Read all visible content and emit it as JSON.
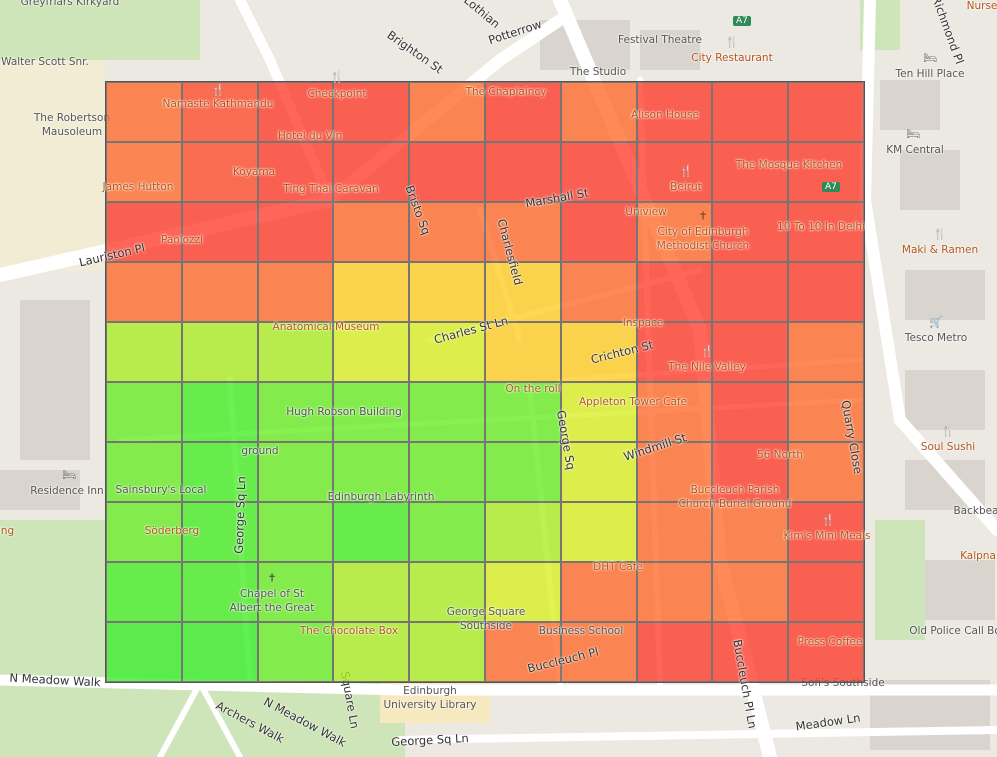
{
  "map": {
    "labels": {
      "greyfriars_kirkyard": "Greyfriars Kirkyard",
      "walter_scott": "Walter Scott Snr.",
      "robertson_mausoleum_1": "The Robertson",
      "robertson_mausoleum_2": "Mausoleum",
      "lothian": "Lothian",
      "brighton_st": "Brighton St",
      "potterrow": "Potterrow",
      "festival_theatre": "Festival Theatre",
      "the_studio": "The Studio",
      "city_restaurant": "City Restaurant",
      "nursery": "Nurse",
      "richmond_pl": "Richmond Pl",
      "ten_hill_place": "Ten Hill Place",
      "namaste": "Namaste Kathmandu",
      "checkpoint": "Checkpoint",
      "chaplaincy": "The Chaplaincy",
      "alison_house": "Alison House",
      "hotel_du_vin": "Hotel du Vin",
      "km_central": "KM Central",
      "koyama": "Koyama",
      "james_hutton": "James Hutton",
      "ting_thai": "Ting Thai Caravan",
      "bristo_sq": "Bristo Sq",
      "marshall_st": "Marshall St",
      "beirut": "Beirut",
      "mosque_kitchen": "The Mosque Kitchen",
      "lauriston_pl": "Lauriston Pl",
      "paolozzi": "Paolozzi",
      "charlesfield": "Charlesfield",
      "uniview": "Uniview",
      "methodist_1": "City of Edinburgh",
      "methodist_2": "Methodist Church",
      "ten_to_ten": "10 To 10 In Delhi",
      "maki_ramen": "Maki & Ramen",
      "anatomical_museum": "Anatomical Museum",
      "charles_st_ln": "Charles St Ln",
      "inspace": "Inspace",
      "tesco_metro": "Tesco Metro",
      "crichton_st": "Crichton St",
      "nile_valley": "The Nile Valley",
      "on_the_roll": "On the roll",
      "hugh_robson": "Hugh Robson Building",
      "appleton_tower": "Appleton Tower Cafe",
      "george_sq": "George Sq",
      "windmill_st": "Windmill St",
      "quarry_close": "Quarry Close",
      "ground": "ground",
      "fifty_six_north": "56 North",
      "soul_sushi": "Soul Sushi",
      "residence_inn": "Residence Inn",
      "sainsburys": "Sainsbury's Local",
      "edinburgh_labyrinth": "Edinburgh Labyrinth",
      "buccleuch_parish": "Buccleuch Parish",
      "church_burial": "Church Burial Ground",
      "backbeat": "Backbea",
      "soderberg": "Söderberg",
      "george_sq_ln_v": "George Sq Ln",
      "kims_mini_meals": "Kim's Mini Meals",
      "ing": "ing",
      "kalpna": "Kalpna",
      "dht_cafe": "DHT Cafe",
      "chapel_1": "Chapel of St",
      "chapel_2": "Albert the Great",
      "george_square_1": "George Square",
      "george_square_2": "Southside",
      "chocolate_box": "The Chocolate Box",
      "business_school": "Business School",
      "press_coffee": "Press Coffee",
      "old_police": "Old Police Call Bo",
      "buccleuch_pl": "Buccleuch Pl",
      "buccleuch_pl_ln": "Buccleuch Pl Ln",
      "sofis": "Sofi's Southside",
      "n_meadow_walk_1": "N Meadow Walk",
      "n_meadow_walk_2": "N Meadow Walk",
      "square_ln": "Square Ln",
      "uni_library_1": "Edinburgh",
      "uni_library_2": "University Library",
      "archers_walk": "Archers Walk",
      "george_sq_ln_h": "George Sq Ln",
      "meadow_ln": "Meadow Ln",
      "a7_1": "A7",
      "a7_2": "A7"
    }
  },
  "heatmap": {
    "rows": 10,
    "cols": 10,
    "legend": null,
    "colors": [
      [
        "#ff6a2a",
        "#ff4a2a",
        "#ff3a2a",
        "#ff3a2a",
        "#ff6a2a",
        "#ff3a2a",
        "#ff6a2a",
        "#ff3a2a",
        "#ff3a2a",
        "#ff3a2a"
      ],
      [
        "#ff6a2a",
        "#ff4a2a",
        "#ff3a2a",
        "#ff3a2a",
        "#ff3a2a",
        "#ff3a2a",
        "#ff3a2a",
        "#ff3a2a",
        "#ff3a2a",
        "#ff3a2a"
      ],
      [
        "#ff3a2a",
        "#ff3a2a",
        "#ff3a2a",
        "#ff6a2a",
        "#ff6a2a",
        "#ff6a2a",
        "#ff3a2a",
        "#ff6a2a",
        "#ff3a2a",
        "#ff3a2a"
      ],
      [
        "#ff6a2a",
        "#ff6a2a",
        "#ff6a2a",
        "#ffcc22",
        "#ffcc22",
        "#ffcc22",
        "#ff6a2a",
        "#ff3a2a",
        "#ff3a2a",
        "#ff3a2a"
      ],
      [
        "#a9ee22",
        "#a9ee22",
        "#a9ee22",
        "#d9f022",
        "#d9f022",
        "#ffcc22",
        "#ffcc22",
        "#ff3a2a",
        "#ff3a2a",
        "#ff6a2a"
      ],
      [
        "#66ee22",
        "#44ee22",
        "#66ee22",
        "#66ee22",
        "#66ee22",
        "#66ee22",
        "#d9f022",
        "#ff6a2a",
        "#ff3a2a",
        "#ff6a2a"
      ],
      [
        "#66ee22",
        "#44ee22",
        "#66ee22",
        "#66ee22",
        "#66ee22",
        "#66ee22",
        "#d9f022",
        "#ff6a2a",
        "#ff3a2a",
        "#ff6a2a"
      ],
      [
        "#66ee22",
        "#44ee22",
        "#66ee22",
        "#44ee22",
        "#66ee22",
        "#a9ee22",
        "#d9f022",
        "#ff6a2a",
        "#ff6a2a",
        "#ff3a2a"
      ],
      [
        "#44ee22",
        "#44ee22",
        "#66ee22",
        "#a9ee22",
        "#a9ee22",
        "#d9f022",
        "#ff6a2a",
        "#ff6a2a",
        "#ff6a2a",
        "#ff3a2a"
      ],
      [
        "#33ee22",
        "#33ee22",
        "#66ee22",
        "#a9ee22",
        "#a9ee22",
        "#ff6a2a",
        "#ff6a2a",
        "#ff3a2a",
        "#ff3a2a",
        "#ff3a2a"
      ]
    ]
  }
}
